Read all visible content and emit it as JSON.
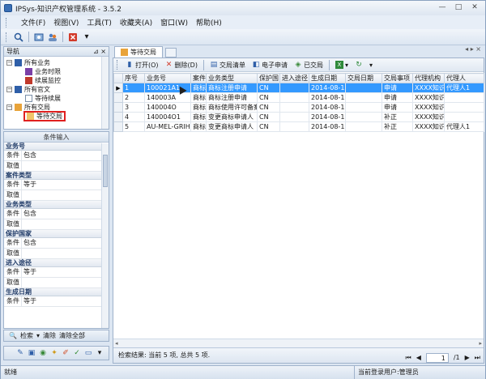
{
  "window": {
    "title": "IPSys-知识产权管理系统 - 3.5.2",
    "min": "—",
    "max": "□",
    "close": "✕"
  },
  "menu": [
    "文件(F)",
    "视图(V)",
    "工具(T)",
    "收藏夹(A)",
    "窗口(W)",
    "帮助(H)"
  ],
  "nav": {
    "header": "导航",
    "pin": "⊿ ×",
    "nodes": [
      {
        "label": "所有业务",
        "level": 0,
        "expander": "−"
      },
      {
        "label": "业务时限",
        "level": 1
      },
      {
        "label": "续展监控",
        "level": 1
      },
      {
        "label": "所有官文",
        "level": 0,
        "expander": "−"
      },
      {
        "label": "等待续展",
        "level": 1
      },
      {
        "label": "所有交局",
        "level": 0,
        "expander": "−"
      },
      {
        "label": "等待交局",
        "level": 1
      }
    ]
  },
  "conditions": {
    "header": "条件输入",
    "groups": [
      {
        "title": "业务号",
        "cond_key": "条件",
        "cond_val": "包含",
        "value_key": "取值"
      },
      {
        "title": "案件类型",
        "cond_key": "条件",
        "cond_val": "等于",
        "value_key": "取值"
      },
      {
        "title": "业务类型",
        "cond_key": "条件",
        "cond_val": "包含",
        "value_key": "取值"
      },
      {
        "title": "保护国家",
        "cond_key": "条件",
        "cond_val": "包含",
        "value_key": "取值"
      },
      {
        "title": "进入途径",
        "cond_key": "条件",
        "cond_val": "等于",
        "value_key": "取值"
      },
      {
        "title": "生成日期",
        "cond_key": "条件",
        "cond_val": "等于",
        "value_key": ""
      }
    ],
    "search": "检索",
    "clear": "清除",
    "clear_all": "清除全部"
  },
  "tab": {
    "label": "等待交局"
  },
  "grid_toolbar": {
    "open": "打开(O)",
    "delete": "删除(D)",
    "handover": "交局清单",
    "e_submit": "电子申请",
    "submitted": "已交局"
  },
  "grid": {
    "columns": [
      "序号",
      "业务号",
      "案件",
      "业务类型",
      "保护国",
      "进入途径",
      "生成日期",
      "交局日期",
      "交局事项",
      "代理机构",
      "代理人"
    ],
    "rows": [
      [
        "1",
        "100021A1",
        "商标",
        "商标注册申请",
        "CN",
        "",
        "2014-08-13",
        "",
        "申请",
        "XXXX知识",
        "代理人1"
      ],
      [
        "2",
        "140003A",
        "商标",
        "商标注册申请",
        "CN",
        "",
        "2014-08-13",
        "",
        "申请",
        "XXXX知识",
        ""
      ],
      [
        "3",
        "140004O",
        "商标",
        "商标使用许可备案",
        "CN",
        "",
        "2014-08-13",
        "",
        "申请",
        "XXXX知识",
        ""
      ],
      [
        "4",
        "140004O1",
        "商标",
        "变更商标申请人",
        "CN",
        "",
        "2014-08-13",
        "",
        "补正",
        "XXXX知识",
        ""
      ],
      [
        "5",
        "AU-MEL-GRIH",
        "商标",
        "变更商标申请人",
        "CN",
        "",
        "2014-08-13",
        "",
        "补正",
        "XXXX知识",
        "代理人1"
      ]
    ]
  },
  "result": {
    "text": "检索结果: 当前 5 项, 总共 5 项.",
    "page": "1",
    "pages": "/1"
  },
  "statusbar": {
    "left": "就绪",
    "right": "当前登录用户:管理员"
  }
}
